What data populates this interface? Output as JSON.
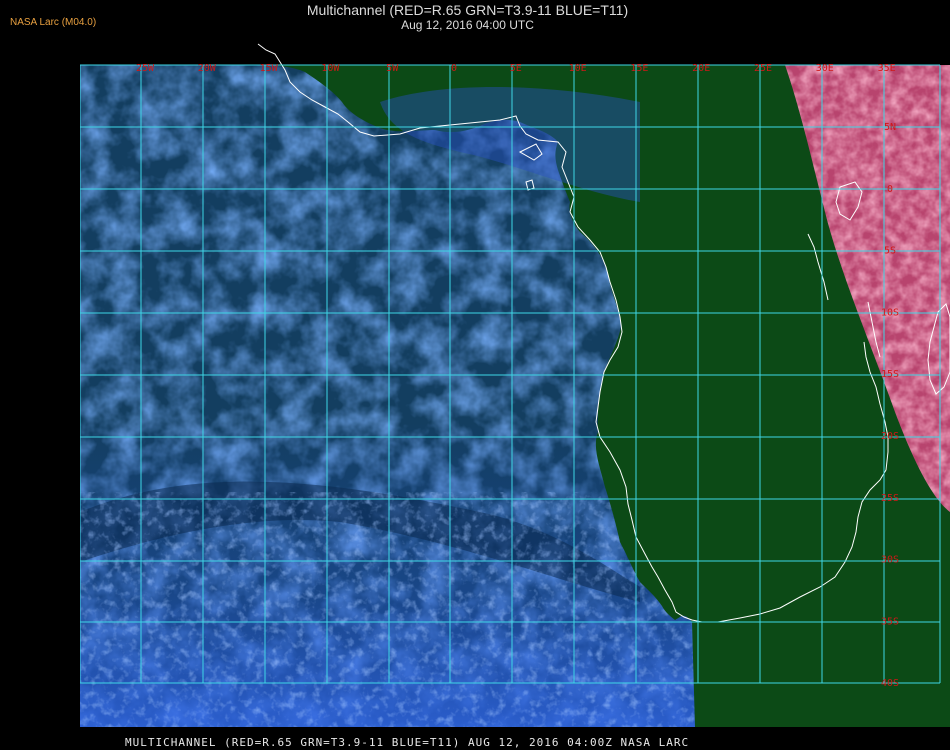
{
  "credit": "NASA Larc (M04.0)",
  "title": "Multichannel (RED=R.65 GRN=T3.9-11 BLUE=T11)",
  "subtitle": "Aug 12, 2016 04:00 UTC",
  "caption": "MULTICHANNEL (RED=R.65 GRN=T3.9-11 BLUE=T11) AUG 12, 2016 04:00Z   NASA LARC",
  "grid": {
    "longitude_labels": [
      "25W",
      "20W",
      "15W",
      "10W",
      "5W",
      "0",
      "5E",
      "10E",
      "15E",
      "20E",
      "25E",
      "30E",
      "35E"
    ],
    "latitude_labels": [
      "5N",
      "0",
      "5S",
      "10S",
      "15S",
      "20S",
      "25S",
      "30S",
      "35S",
      "40S"
    ],
    "line_color": "#3ed6e6",
    "label_color": "#d01818"
  },
  "colors": {
    "ocean_clear": "#0a3d12",
    "low_cloud": "#2f62d8",
    "land_day": "#c0507a",
    "coastline": "#ffffff"
  }
}
